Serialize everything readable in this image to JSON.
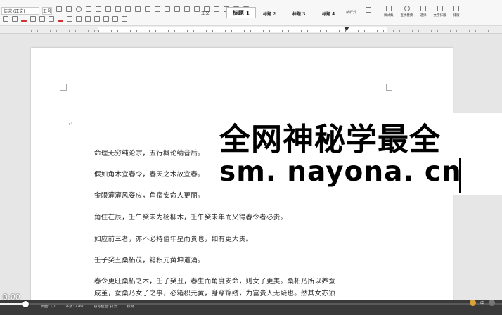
{
  "ribbon": {
    "font_name": "仿宋 (正文)",
    "font_size": "五号",
    "style_normal": "正文",
    "style_h1": "标题 1",
    "style_h2": "标题 2",
    "style_h3": "标题 3",
    "style_h4": "标题 4",
    "style_more": "新样式",
    "tools": [
      {
        "label": "样式集",
        "icon": "style-set-icon"
      },
      {
        "label": "查找替换",
        "icon": "search-icon"
      },
      {
        "label": "选择",
        "icon": "select-icon"
      },
      {
        "label": "文字排版",
        "icon": "text-layout-icon"
      },
      {
        "label": "排版",
        "icon": "layout-icon"
      }
    ]
  },
  "document": {
    "para_mark": "↵",
    "lines": [
      "命理无穷纯论宗，五行概论纳音后。",
      "假如角木宜春令，春天之木故宜春。",
      "金眼灌灌风姿应，角宿安命人更丽。",
      "角住在辰，壬午癸未为杨柳木，壬午癸未年而又得春令者必贵。",
      "如应前三者，亦不必持值年星而贵也，如有更大贵。",
      "壬子癸丑桑柘茂，箱积元黄坤道涌。",
      "春令更旺桑柘之木，壬子癸丑，春生而角度安命，则女子更美。桑柘乃所以养蚕",
      "成茧，蚕桑乃女子之事，必箱积元黄，身穿锦绣，为富贵人无疑也。然其女亦须"
    ]
  },
  "watermark": {
    "line1": "全网神秘学最全",
    "line2": "sm. nayona. cn"
  },
  "statusbar": {
    "items": [
      "页面: 1/1",
      "字数: 2261",
      "拼写检查: 打开",
      "校对"
    ]
  },
  "video": {
    "time": "0:00",
    "progress": 0.05
  }
}
